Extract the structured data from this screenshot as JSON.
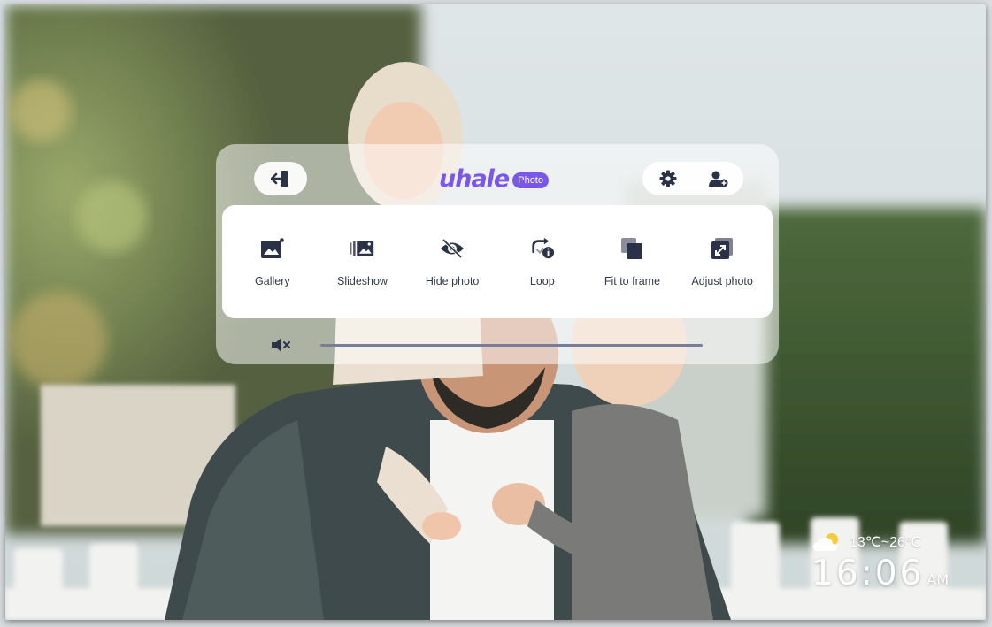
{
  "app": {
    "logo_text": "uhale",
    "logo_badge": "Photo"
  },
  "menu": {
    "items": [
      {
        "label": "Gallery",
        "icon": "gallery-icon"
      },
      {
        "label": "Slideshow",
        "icon": "slideshow-icon"
      },
      {
        "label": "Hide photo",
        "icon": "hide-photo-icon"
      },
      {
        "label": "Loop",
        "icon": "loop-icon"
      },
      {
        "label": "Fit to frame",
        "icon": "fit-to-frame-icon"
      },
      {
        "label": "Adjust photo",
        "icon": "adjust-photo-icon"
      }
    ]
  },
  "header": {
    "exit_icon": "exit-icon",
    "settings_icon": "gear-icon",
    "add_user_icon": "add-user-icon"
  },
  "volume": {
    "icon": "mute-icon",
    "level": 0
  },
  "weather": {
    "icon": "partly-cloudy-icon",
    "range": "13℃~26℃"
  },
  "clock": {
    "time": "16:06",
    "ampm": "AM"
  },
  "colors": {
    "brand": "#7b56ea",
    "icon_dark": "#2b3147"
  }
}
